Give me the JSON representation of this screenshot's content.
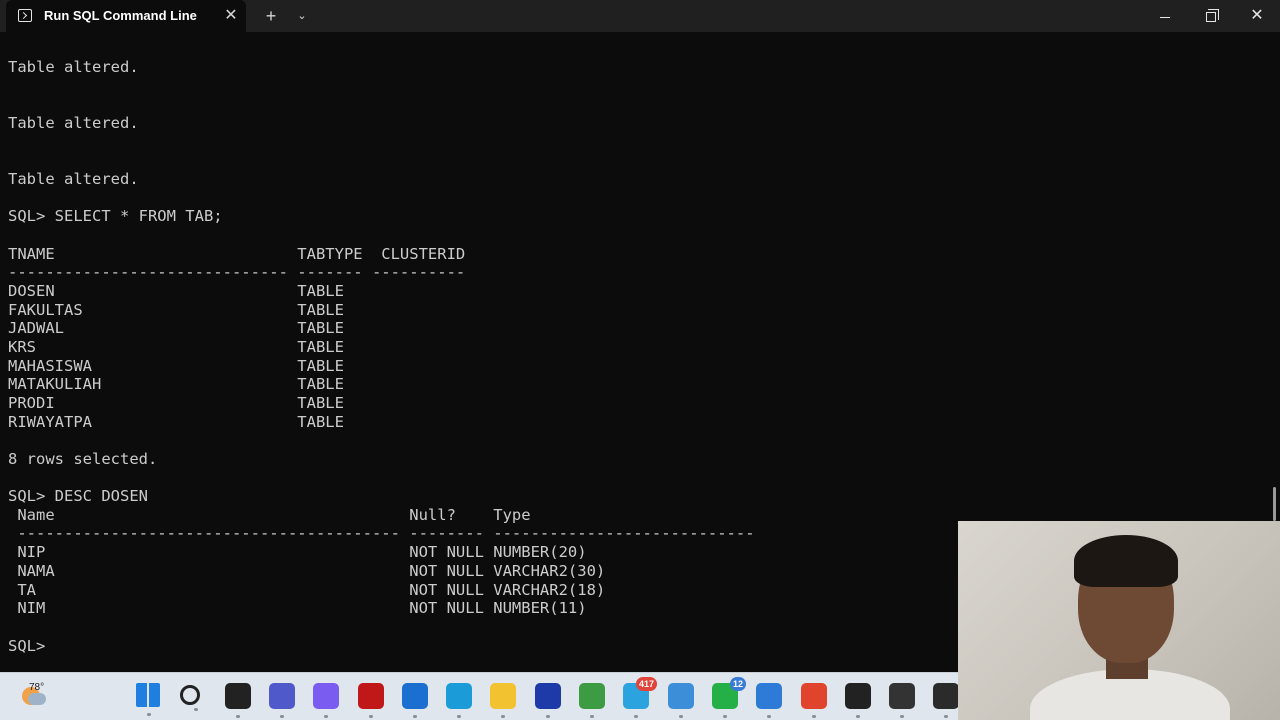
{
  "window": {
    "tab_title": "Run SQL Command Line",
    "close_tab_glyph": "✕",
    "new_tab_glyph": "+",
    "dropdown_glyph": "⌄",
    "close_glyph": "✕"
  },
  "terminal": {
    "lines": [
      "Table altered.",
      "Table altered.",
      "Table altered.",
      "SQL> SELECT * FROM TAB;",
      "TNAME                          TABTYPE  CLUSTERID",
      "------------------------------ ------- ----------",
      "DOSEN                          TABLE",
      "FAKULTAS                       TABLE",
      "JADWAL                         TABLE",
      "KRS                            TABLE",
      "MAHASISWA                      TABLE",
      "MATAKULIAH                     TABLE",
      "PRODI                          TABLE",
      "RIWAYATPA                      TABLE",
      "8 rows selected.",
      "SQL> DESC DOSEN",
      " Name                                      Null?    Type",
      " ----------------------------------------- -------- ----------------------------",
      " NIP                                       NOT NULL NUMBER(20)",
      " NAMA                                      NOT NULL VARCHAR2(30)",
      " TA                                        NOT NULL VARCHAR2(18)",
      " NIM                                       NOT NULL NUMBER(11)",
      "SQL>"
    ]
  },
  "taskbar": {
    "weather_temp": "78°",
    "items": [
      {
        "name": "start-icon",
        "color": "#1f7fe0"
      },
      {
        "name": "search-icon",
        "color": "#222222"
      },
      {
        "name": "task-view-icon",
        "color": "#222222"
      },
      {
        "name": "teams-icon",
        "color": "#5059c9"
      },
      {
        "name": "copilot-icon",
        "color": "#7a5cf0"
      },
      {
        "name": "mcafee-icon",
        "color": "#c01818"
      },
      {
        "name": "microsoft-store-icon",
        "color": "#1a6fd0"
      },
      {
        "name": "edge-icon",
        "color": "#1b9bd8"
      },
      {
        "name": "file-explorer-icon",
        "color": "#f2c230"
      },
      {
        "name": "l-app-icon",
        "color": "#1e3aa8"
      },
      {
        "name": "spreadsheet-app-icon",
        "color": "#3d9c43"
      },
      {
        "name": "telegram-icon",
        "color": "#2aa3df",
        "badge": "417"
      },
      {
        "name": "notepad-icon",
        "color": "#3c8ed8"
      },
      {
        "name": "whatsapp-icon",
        "color": "#25b047",
        "badge": "12"
      },
      {
        "name": "photos-icon",
        "color": "#2d7bd6"
      },
      {
        "name": "chrome-icon",
        "color": "#e0442c"
      },
      {
        "name": "media-player-icon",
        "color": "#222222"
      },
      {
        "name": "obs-icon",
        "color": "#333333"
      },
      {
        "name": "terminal-icon",
        "color": "#2b2b2b"
      }
    ]
  }
}
